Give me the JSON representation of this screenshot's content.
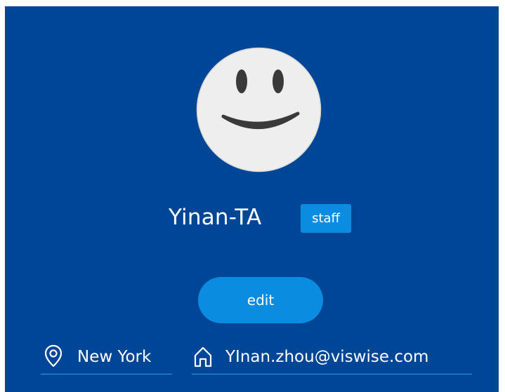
{
  "profile": {
    "avatar_icon": "smiley-face-icon",
    "name": "Yinan-TA",
    "role_badge": "staff",
    "edit_label": "edit",
    "location": {
      "icon": "map-pin-icon",
      "value": "New York"
    },
    "email": {
      "icon": "home-icon",
      "value": "YInan.zhou@viswise.com"
    }
  },
  "colors": {
    "background": "#004696",
    "accent": "#0a8ce0",
    "avatar_fill": "#eeeeee",
    "face_features": "#3a3a3a",
    "underline": "#2a9df0"
  }
}
